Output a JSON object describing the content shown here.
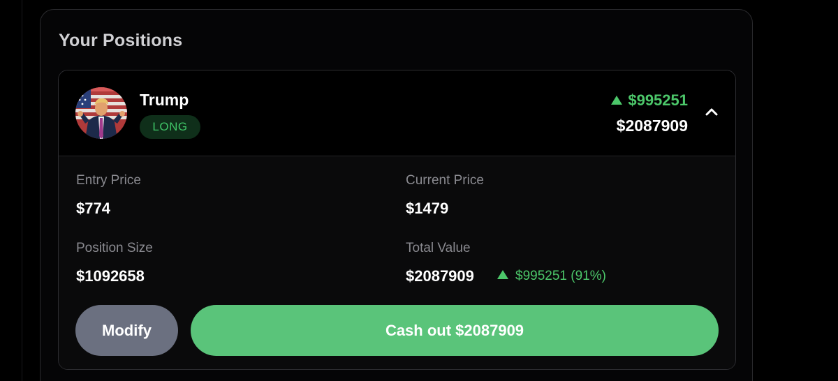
{
  "panel": {
    "title": "Your Positions"
  },
  "position": {
    "asset_name": "Trump",
    "side": "LONG",
    "pnl_amount": "$995251",
    "current_value": "$2087909",
    "avatar_icon": "portrait-avatar",
    "expand_icon": "chevron-up-icon"
  },
  "details": {
    "entry_price_label": "Entry Price",
    "entry_price_value": "$774",
    "current_price_label": "Current Price",
    "current_price_value": "$1479",
    "position_size_label": "Position Size",
    "position_size_value": "$1092658",
    "total_value_label": "Total Value",
    "total_value_value": "$2087909",
    "total_change": "$995251 (91%)"
  },
  "actions": {
    "modify_label": "Modify",
    "cashout_label": "Cash out $2087909"
  },
  "colors": {
    "positive": "#4cc76a",
    "cashout_button": "#5ac47a",
    "modify_button": "#6b7080",
    "long_badge_bg": "#0f2f1a"
  }
}
